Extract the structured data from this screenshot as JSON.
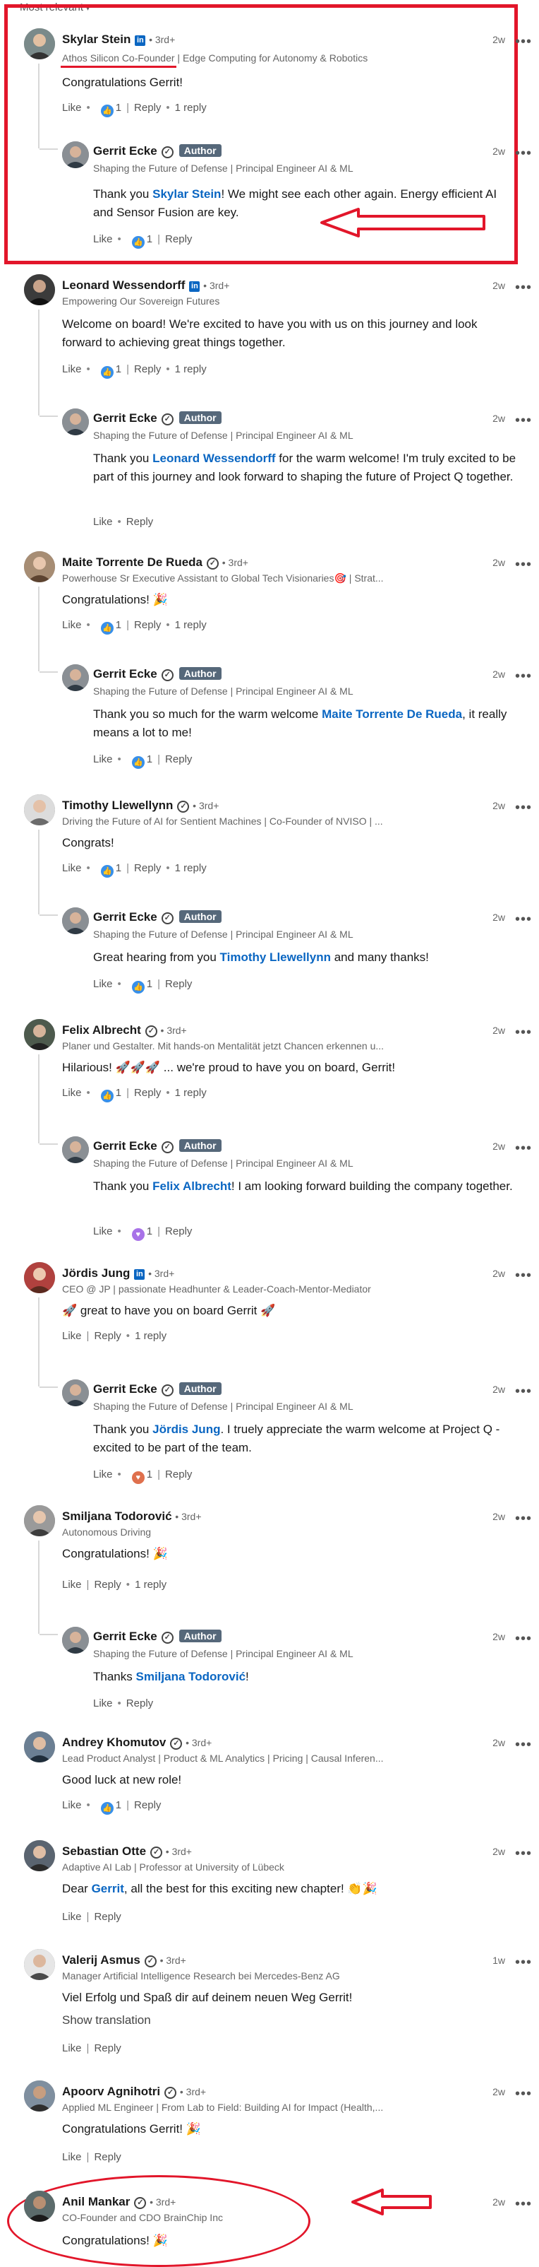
{
  "sort": {
    "label": "Most relevant",
    "caret": "▾"
  },
  "colors": {
    "accent": "#0a66c2",
    "annotation_red": "#e2162a"
  },
  "comments": [
    {
      "name": "Skylar Stein",
      "linkedin_badge": "in",
      "degree": "• 3rd+",
      "headline": "Athos Silicon Co-Founder | Edge Computing for Autonomy & Robotics",
      "time": "2w",
      "more": "•••",
      "text": "Congratulations Gerrit!",
      "actions": {
        "like": "Like",
        "count": "1",
        "reply": "Reply",
        "replies": "1 reply"
      },
      "reply": {
        "name": "Gerrit Ecke",
        "badge": "Author",
        "headline": "Shaping the Future of Defense | Principal Engineer AI & ML",
        "time": "2w",
        "more": "•••",
        "text_before": "Thank you ",
        "mention": "Skylar Stein",
        "text_after": "! We might see each other again. Energy efficient AI and Sensor Fusion are key.",
        "actions": {
          "like": "Like",
          "count": "1",
          "reply": "Reply"
        }
      }
    },
    {
      "name": "Leonard Wessendorff",
      "linkedin_badge": "in",
      "degree": "• 3rd+",
      "headline": "Empowering Our Sovereign Futures",
      "time": "2w",
      "more": "•••",
      "text": "Welcome on board! We're excited to have you with us on this journey and look forward to achieving great things together.",
      "actions": {
        "like": "Like",
        "count": "1",
        "reply": "Reply",
        "replies": "1 reply"
      },
      "reply": {
        "name": "Gerrit Ecke",
        "badge": "Author",
        "headline": "Shaping the Future of Defense | Principal Engineer AI & ML",
        "time": "2w",
        "more": "•••",
        "text_before": "Thank you ",
        "mention": "Leonard Wessendorff",
        "text_after": " for the warm welcome! I'm truly excited to be part of this journey and look forward to shaping the future of Project Q together.",
        "actions": {
          "like": "Like",
          "reply": "Reply"
        }
      }
    },
    {
      "name": "Maite Torrente De Rueda",
      "verified": "✓",
      "degree": "• 3rd+",
      "headline": "Powerhouse Sr Executive Assistant to Global Tech Visionaries🎯 | Strat...",
      "time": "2w",
      "more": "•••",
      "text": "Congratulations! 🎉",
      "actions": {
        "like": "Like",
        "count": "1",
        "reply": "Reply",
        "replies": "1 reply"
      },
      "reply": {
        "name": "Gerrit Ecke",
        "badge": "Author",
        "headline": "Shaping the Future of Defense | Principal Engineer AI & ML",
        "time": "2w",
        "more": "•••",
        "text_before": "Thank you so much for the warm welcome ",
        "mention": "Maite Torrente De Rueda",
        "text_after": ", it really means a lot to me!",
        "actions": {
          "like": "Like",
          "count": "1",
          "reply": "Reply"
        }
      }
    },
    {
      "name": "Timothy Llewellynn",
      "verified": "✓",
      "degree": "• 3rd+",
      "headline": "Driving the Future of AI for Sentient Machines | Co-Founder of NVISO | ...",
      "time": "2w",
      "more": "•••",
      "text": "Congrats!",
      "actions": {
        "like": "Like",
        "count": "1",
        "reply": "Reply",
        "replies": "1 reply"
      },
      "reply": {
        "name": "Gerrit Ecke",
        "badge": "Author",
        "headline": "Shaping the Future of Defense | Principal Engineer AI & ML",
        "time": "2w",
        "more": "•••",
        "text_before": "Great hearing from you ",
        "mention": "Timothy Llewellynn",
        "text_after": " and many thanks!",
        "actions": {
          "like": "Like",
          "count": "1",
          "reply": "Reply"
        }
      }
    },
    {
      "name": "Felix Albrecht",
      "verified": "✓",
      "degree": "• 3rd+",
      "headline": "Planer und Gestalter. Mit hands-on Mentalität jetzt Chancen erkennen u...",
      "time": "2w",
      "more": "•••",
      "text": "Hilarious! 🚀🚀🚀 ... we're proud to have you on board, Gerrit!",
      "actions": {
        "like": "Like",
        "count": "1",
        "reply": "Reply",
        "replies": "1 reply"
      },
      "reply": {
        "name": "Gerrit Ecke",
        "badge": "Author",
        "headline": "Shaping the Future of Defense | Principal Engineer AI & ML",
        "time": "2w",
        "more": "•••",
        "text_before": "Thank you ",
        "mention": "Felix Albrecht",
        "text_after": "! I am looking forward building the company together.",
        "actions": {
          "like": "Like",
          "count": "1",
          "reply": "Reply"
        }
      }
    },
    {
      "name": "Jördis Jung",
      "linkedin_badge": "in",
      "degree": "• 3rd+",
      "headline": "CEO @ JP | passionate Headhunter & Leader-Coach-Mentor-Mediator",
      "time": "2w",
      "more": "•••",
      "text": "🚀 great to have you on board Gerrit 🚀",
      "actions": {
        "like": "Like",
        "reply": "Reply",
        "replies": "1 reply"
      },
      "reply": {
        "name": "Gerrit Ecke",
        "badge": "Author",
        "headline": "Shaping the Future of Defense | Principal Engineer AI & ML",
        "time": "2w",
        "more": "•••",
        "text_before": "Thank you ",
        "mention": "Jördis Jung",
        "text_after": ". I truely appreciate the warm welcome at Project Q - excited to be part of the team.",
        "actions": {
          "like": "Like",
          "count": "1",
          "reply": "Reply"
        }
      }
    },
    {
      "name": "Smiljana Todorović",
      "degree": "• 3rd+",
      "headline": "Autonomous Driving",
      "time": "2w",
      "more": "•••",
      "text": "Congratulations! 🎉",
      "actions": {
        "like": "Like",
        "reply": "Reply",
        "replies": "1 reply"
      },
      "reply": {
        "name": "Gerrit Ecke",
        "badge": "Author",
        "headline": "Shaping the Future of Defense | Principal Engineer AI & ML",
        "time": "2w",
        "more": "•••",
        "text_before": "Thanks ",
        "mention": "Smiljana Todorović",
        "text_after": "!",
        "actions": {
          "like": "Like",
          "reply": "Reply"
        }
      }
    },
    {
      "name": "Andrey Khomutov",
      "verified": "✓",
      "degree": "• 3rd+",
      "headline": "Lead Product Analyst | Product & ML Analytics | Pricing | Causal Inferen...",
      "time": "2w",
      "more": "•••",
      "text": "Good luck at new role!",
      "actions": {
        "like": "Like",
        "count": "1",
        "reply": "Reply"
      }
    },
    {
      "name": "Sebastian Otte",
      "verified": "✓",
      "degree": "• 3rd+",
      "headline": "Adaptive AI Lab | Professor at University of Lübeck",
      "time": "2w",
      "more": "•••",
      "text_before": "Dear ",
      "mention": "Gerrit",
      "text_after": ", all the best for this exciting new chapter! 👏🎉",
      "actions": {
        "like": "Like",
        "reply": "Reply"
      }
    },
    {
      "name": "Valerij Asmus",
      "verified": "✓",
      "degree": "• 3rd+",
      "headline": "Manager Artificial Intelligence Research bei Mercedes-Benz AG",
      "time": "1w",
      "more": "•••",
      "text": "Viel Erfolg und Spaß dir auf deinem neuen Weg Gerrit!",
      "show_translation": "Show translation",
      "actions": {
        "like": "Like",
        "reply": "Reply"
      }
    },
    {
      "name": "Apoorv Agnihotri",
      "verified": "✓",
      "degree": "• 3rd+",
      "headline": "Applied ML Engineer | From Lab to Field: Building AI for Impact (Health,...",
      "time": "2w",
      "more": "•••",
      "text": "Congratulations Gerrit! 🎉",
      "actions": {
        "like": "Like",
        "reply": "Reply"
      }
    },
    {
      "name": "Anil Mankar",
      "verified": "✓",
      "degree": "• 3rd+",
      "headline": "CO-Founder and CDO BrainChip Inc",
      "time": "2w",
      "more": "•••",
      "text": "Congratulations! 🎉"
    }
  ]
}
